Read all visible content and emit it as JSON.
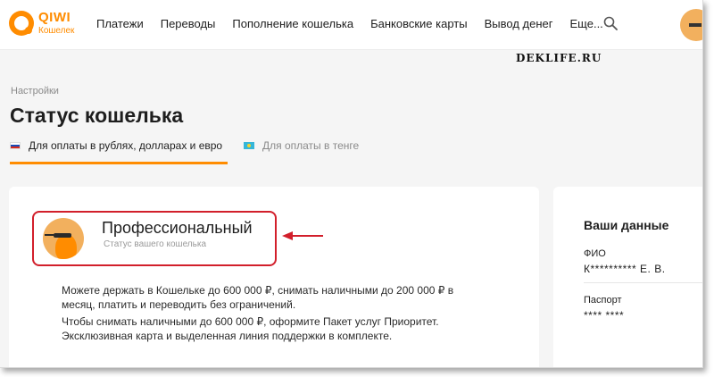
{
  "logo": {
    "name": "QIWI",
    "subtitle": "Кошелек"
  },
  "nav": [
    "Платежи",
    "Переводы",
    "Пополнение кошелька",
    "Банковские карты",
    "Вывод денег",
    "Еще..."
  ],
  "watermark": "DEKLIFE.RU",
  "breadcrumb": "Настройки",
  "page_title": "Статус кошелька",
  "tabs": [
    {
      "label": "Для оплаты в рублях, долларах и евро",
      "active": true
    },
    {
      "label": "Для оплаты в тенге",
      "active": false
    }
  ],
  "status": {
    "name": "Профессиональный",
    "caption": "Статус вашего кошелька"
  },
  "description": {
    "p1": "Можете держать в Кошельке до 600 000 ₽, снимать наличными до 200 000 ₽ в месяц, платить и переводить без ограничений.",
    "p2": "Чтобы снимать наличными до 600 000 ₽, оформите Пакет услуг Приоритет. Эксклюзивная карта и выделенная линия поддержки в комплекте."
  },
  "side": {
    "title": "Ваши данные",
    "fio_label": "ФИО",
    "fio_value": "К********** Е. В.",
    "passport_label": "Паспорт",
    "passport_value": "**** ****"
  },
  "colors": {
    "accent": "#ff8c00",
    "highlight": "#d21f2b",
    "background": "#f5f5f5"
  },
  "icons": {
    "search": "search-icon",
    "avatar": "user-avatar-icon",
    "arrow": "arrow-left-icon"
  }
}
